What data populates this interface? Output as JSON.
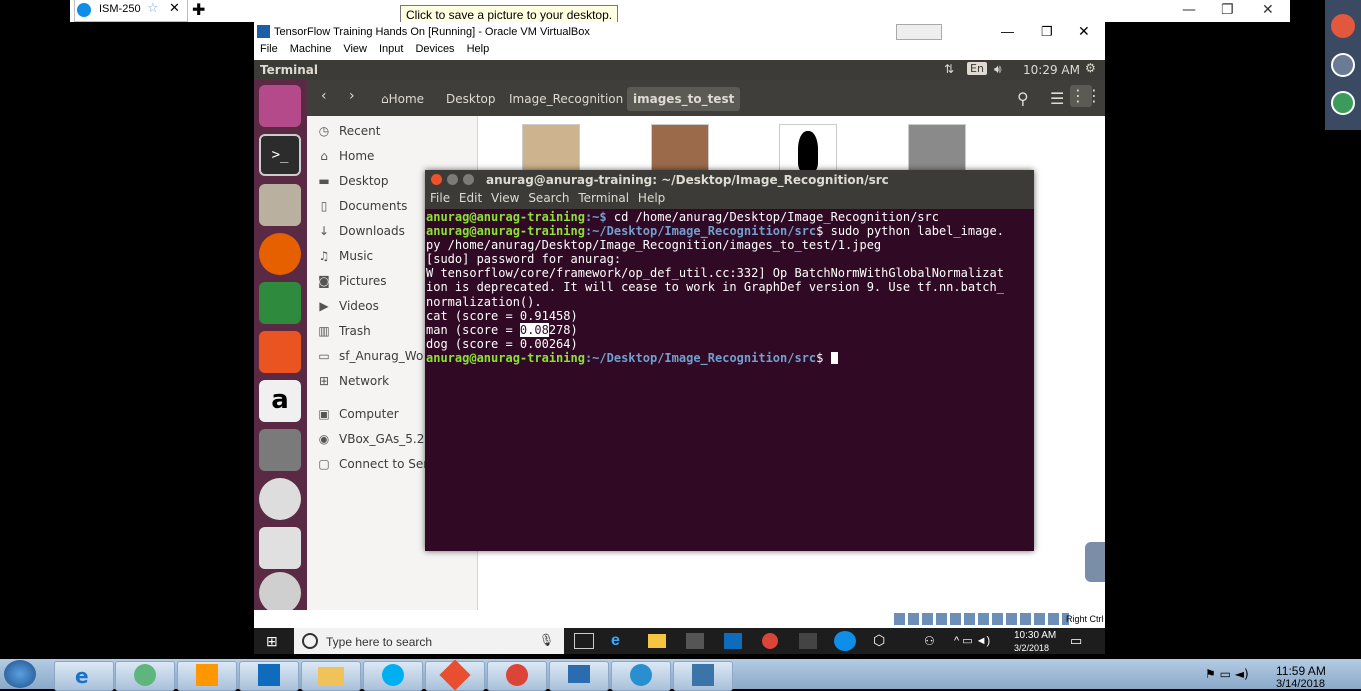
{
  "browser": {
    "tab_label": "ISM-250",
    "tooltip": "Click to save a picture to your desktop."
  },
  "vbox": {
    "title": "TensorFlow Training Hands On [Running] - Oracle VM VirtualBox",
    "menu": [
      "File",
      "Machine",
      "View",
      "Input",
      "Devices",
      "Help"
    ],
    "status_right": "Right Ctrl"
  },
  "ubuntu": {
    "topbar_title": "Terminal",
    "keyboard": "En",
    "clock": "10:29 AM"
  },
  "nautilus": {
    "breadcrumbs": [
      "Home",
      "Desktop",
      "Image_Recognition",
      "images_to_test"
    ],
    "sidebar": [
      "Recent",
      "Home",
      "Desktop",
      "Documents",
      "Downloads",
      "Music",
      "Pictures",
      "Videos",
      "Trash",
      "sf_Anurag_Wo",
      "Network",
      "Computer",
      "VBox_GAs_5.2.",
      "Connect to Serv"
    ]
  },
  "terminal": {
    "title": "anurag@anurag-training: ~/Desktop/Image_Recognition/src",
    "menu": [
      "File",
      "Edit",
      "View",
      "Search",
      "Terminal",
      "Help"
    ],
    "lines": {
      "l1_user": "anurag@anurag-training",
      "l1_path": ":~$",
      "l1_cmd": " cd /home/anurag/Desktop/Image_Recognition/src",
      "l2_user": "anurag@anurag-training",
      "l2_path": ":~/Desktop/Image_Recognition/src",
      "l2_cmd": "$ sudo python label_image.",
      "l3": "py /home/anurag/Desktop/Image_Recognition/images_to_test/1.jpeg",
      "l4": "[sudo] password for anurag:",
      "l5": "W tensorflow/core/framework/op_def_util.cc:332] Op BatchNormWithGlobalNormalizat",
      "l6": "ion is deprecated. It will cease to work in GraphDef version 9. Use tf.nn.batch_",
      "l7": "normalization().",
      "l8": "cat (score = 0.91458)",
      "l9a": "man (score = ",
      "l9sel": "0.08",
      "l9b": "278)",
      "l10": "dog (score = 0.00264)",
      "l11_user": "anurag@anurag-training",
      "l11_path": ":~/Desktop/Image_Recognition/src",
      "l11_prompt": "$ "
    }
  },
  "win10": {
    "search_placeholder": "Type here to search",
    "time": "10:30 AM",
    "date": "3/2/2018"
  },
  "win7": {
    "time": "11:59 AM",
    "date": "3/14/2018"
  }
}
